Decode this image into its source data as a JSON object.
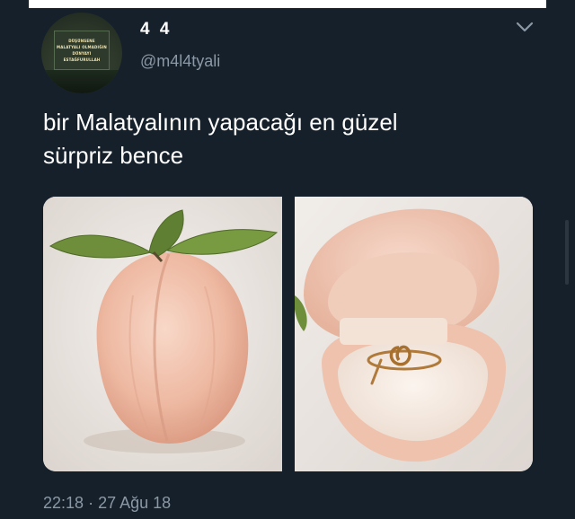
{
  "tweet": {
    "display_name": "4 4",
    "handle": "@m4l4tyali",
    "text_line1": "bir Malatyalının yapacağı en güzel",
    "text_line2": "sürpriz bence",
    "time": "22:18",
    "separator": "·",
    "date": "27 Ağu 18"
  },
  "avatar": {
    "sign_lines": [
      "DÜŞÜNSENE",
      "MALATYALI OLMADIĞIN",
      "DÜNYAYI",
      "ESTAĞFURULLAH"
    ]
  },
  "icons": {
    "menu": "chevron-down-icon"
  },
  "colors": {
    "background": "#15202b",
    "text_primary": "#ffffff",
    "text_secondary": "#8b98a5",
    "peach": "#f0c3ad",
    "leaf": "#6b8a3a"
  }
}
